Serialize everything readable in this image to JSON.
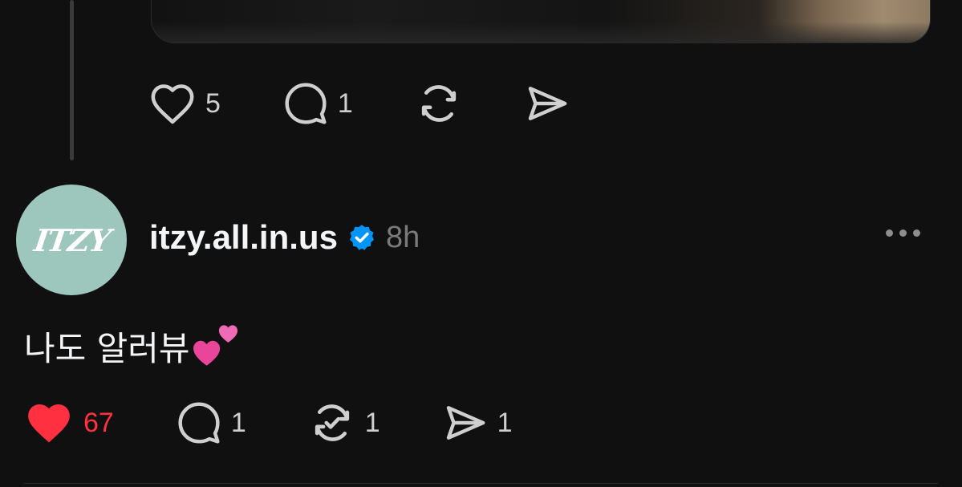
{
  "upper_post": {
    "likes": "5",
    "replies": "1"
  },
  "post": {
    "avatar_logo_text": "ITZY",
    "username": "itzy.all.in.us",
    "time": "8h",
    "text": "나도 알러뷰",
    "likes": "67",
    "replies": "1",
    "reposts": "1",
    "shares": "1"
  },
  "colors": {
    "like_active": "#ff3040",
    "verified": "#0095f6",
    "avatar_bg": "#9dc6bc"
  },
  "icons": {
    "like": "heart-icon",
    "reply": "comment-icon",
    "repost": "repost-icon",
    "share": "send-icon",
    "verified": "verified-badge-icon",
    "more": "more-dots-icon"
  }
}
